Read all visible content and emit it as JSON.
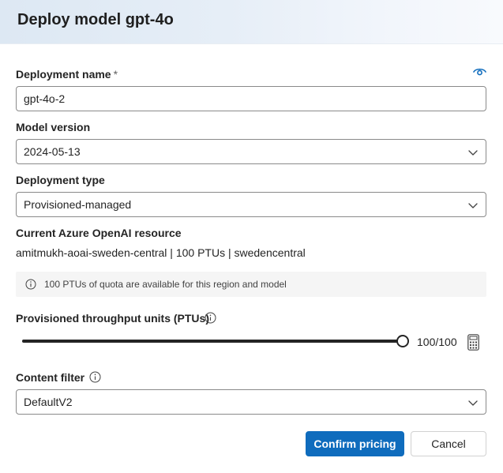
{
  "dialog": {
    "title": "Deploy model gpt-4o",
    "deployment_name": {
      "label": "Deployment name",
      "required_mark": "*",
      "value": "gpt-4o-2"
    },
    "model_version": {
      "label": "Model version",
      "value": "2024-05-13"
    },
    "deployment_type": {
      "label": "Deployment type",
      "value": "Provisioned-managed"
    },
    "resource": {
      "label": "Current Azure OpenAI resource",
      "value": "amitmukh-aoai-sweden-central | 100 PTUs | swedencentral"
    },
    "info_message": "100 PTUs of quota are available for this region and model",
    "ptu": {
      "label": "Provisioned throughput units (PTUs)",
      "value_text": "100/100",
      "level": 1.0
    },
    "content_filter": {
      "label": "Content filter",
      "value": "DefaultV2"
    },
    "buttons": {
      "confirm": "Confirm pricing",
      "cancel": "Cancel"
    },
    "colors": {
      "primary": "#0f6cbd",
      "header_gradient_start": "#dde8f3",
      "eye_icon": "#0f6cbd"
    },
    "icons": [
      "eye-icon",
      "chevron-down-icon",
      "info-icon",
      "calculator-icon"
    ]
  }
}
